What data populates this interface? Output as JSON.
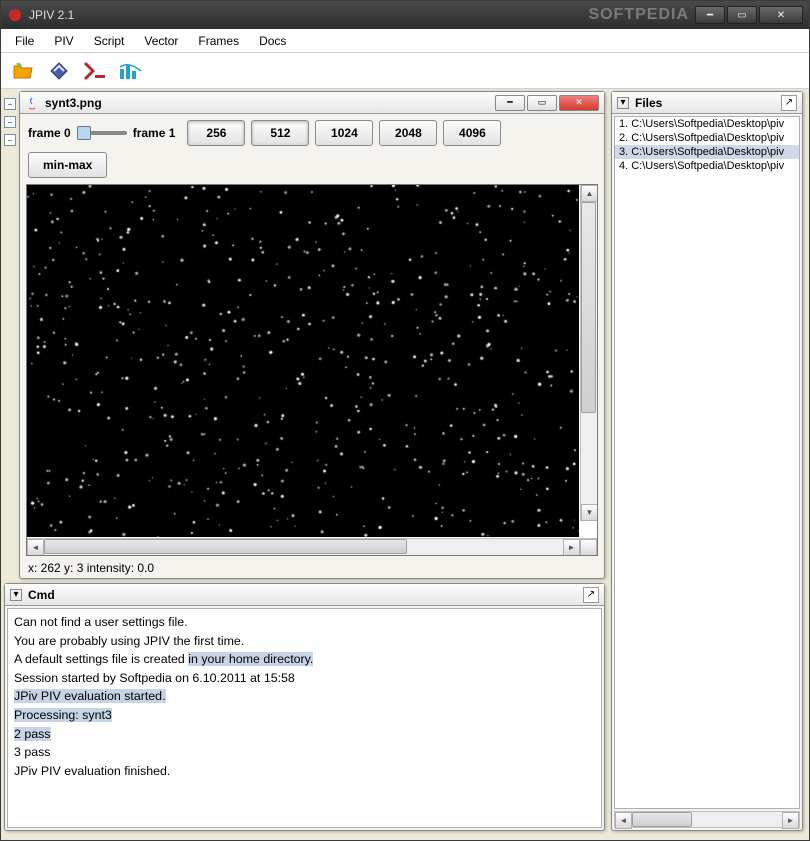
{
  "app": {
    "title": "JPIV 2.1",
    "watermark": "SOFTPEDIA"
  },
  "menu": [
    "File",
    "PIV",
    "Script",
    "Vector",
    "Frames",
    "Docs"
  ],
  "image_window": {
    "title": "synt3.png",
    "frame_label_0": "frame 0",
    "frame_label_1": "frame 1",
    "zoom_levels": [
      "256",
      "512",
      "1024",
      "2048",
      "4096"
    ],
    "minmax": "min-max",
    "status": "x: 262 y: 3 intensity: 0.0"
  },
  "files_panel": {
    "title": "Files",
    "items": [
      "1. C:\\Users\\Softpedia\\Desktop\\piv",
      "2. C:\\Users\\Softpedia\\Desktop\\piv",
      "3. C:\\Users\\Softpedia\\Desktop\\piv",
      "4. C:\\Users\\Softpedia\\Desktop\\piv"
    ],
    "selected": 2
  },
  "cmd_panel": {
    "title": "Cmd",
    "lines": [
      {
        "t": "Can not find a user settings file."
      },
      {
        "t": "You are probably using JPIV the first time."
      },
      {
        "t": "A default settings file is created ",
        "tail": "in your home directory.",
        "hl": true
      },
      {
        "t": "Session started by Softpedia on 6.10.2011 at 15:58"
      },
      {
        "t": "JPiv PIV evaluation started.",
        "hl_all": true
      },
      {
        "t": "Processing: synt3",
        "hl_all": true
      },
      {
        "t": "2 pass",
        "hl_all": true
      },
      {
        "t": "3 pass"
      },
      {
        "t": "JPiv PIV evaluation finished."
      }
    ]
  }
}
